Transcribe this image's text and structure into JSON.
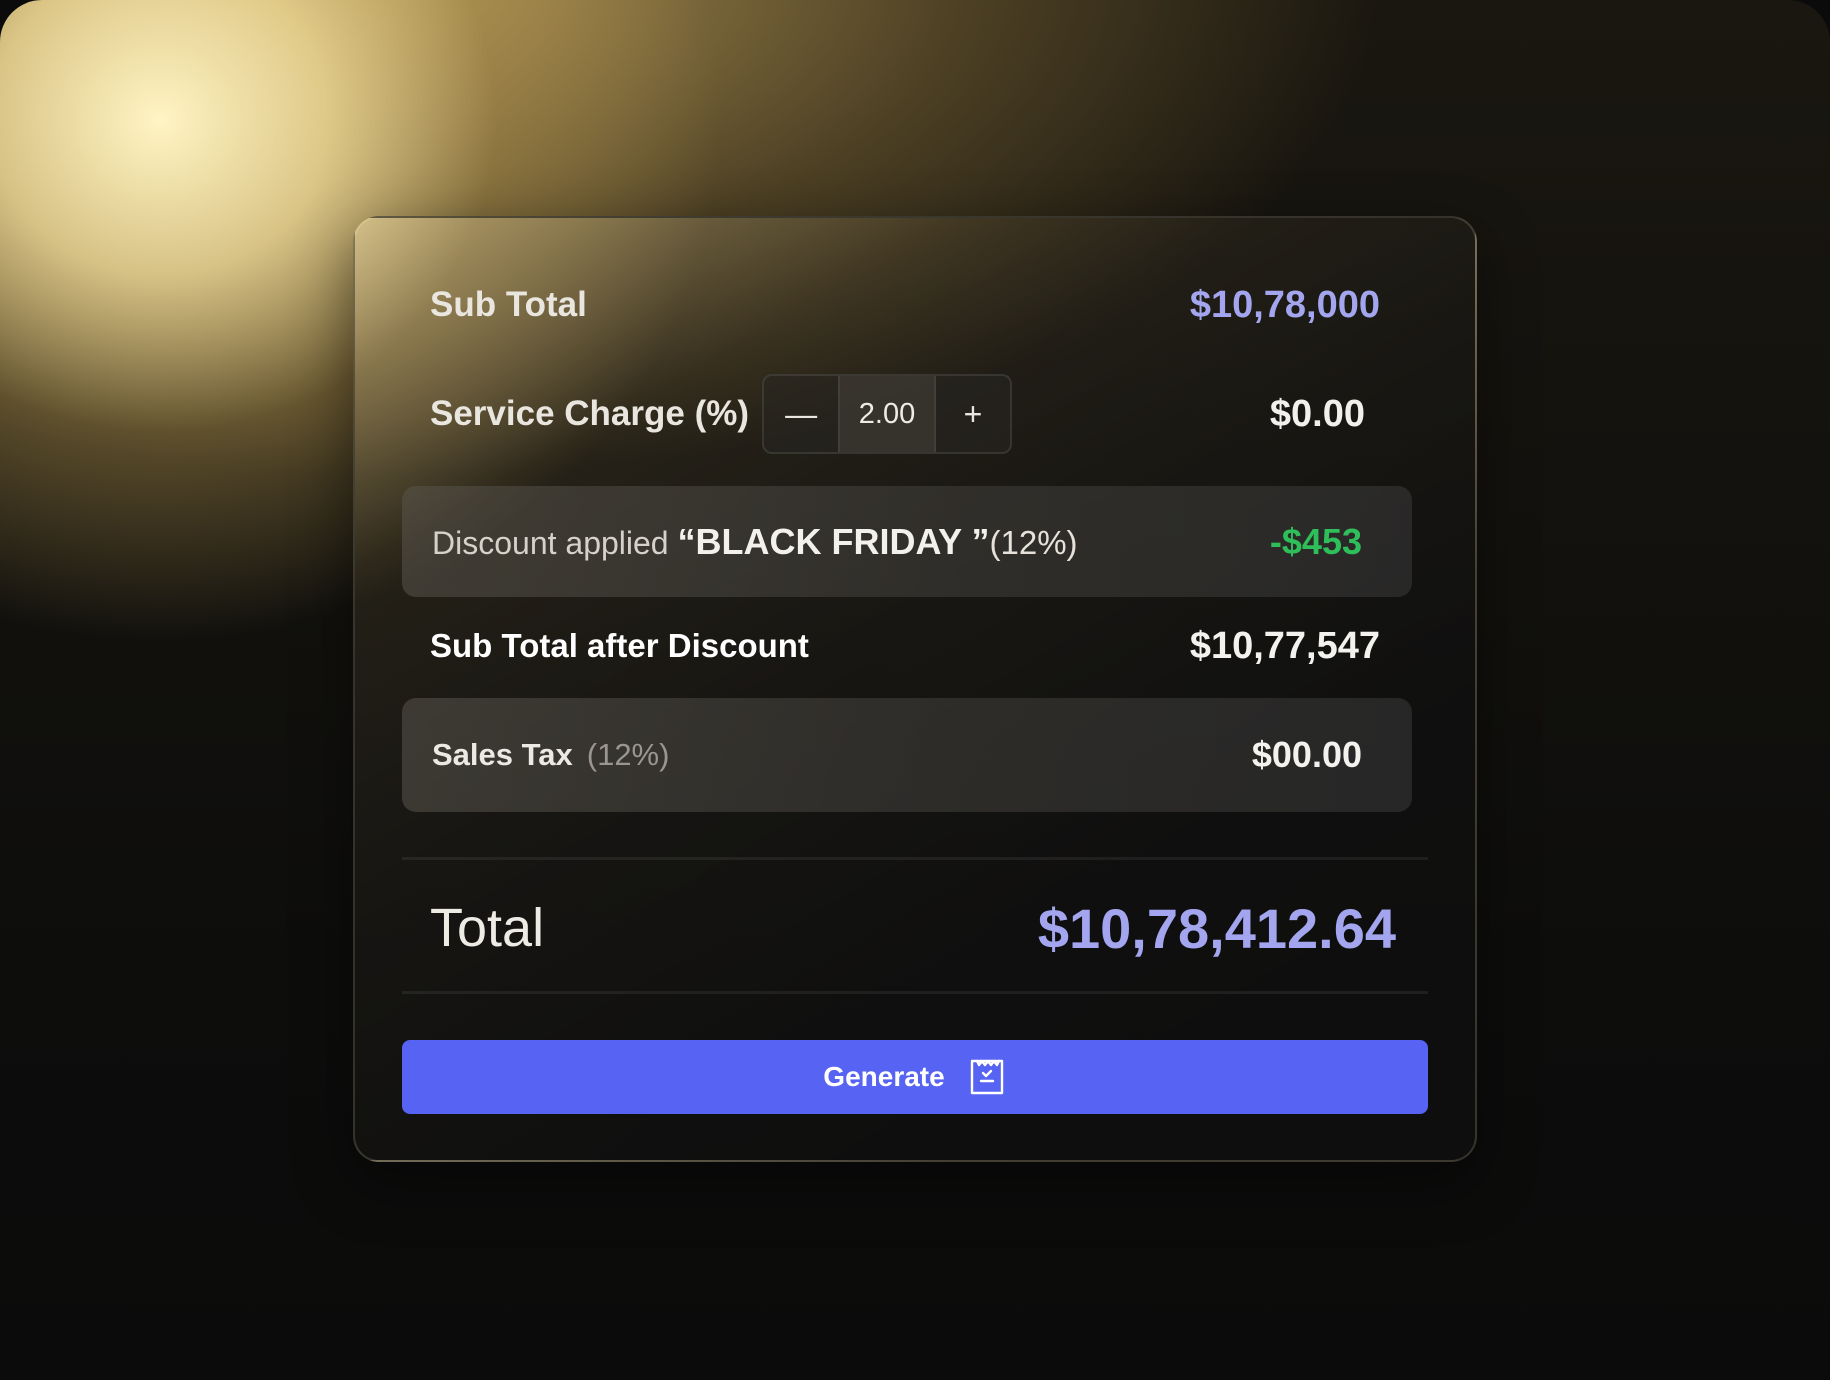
{
  "summary": {
    "sub_total": {
      "label": "Sub Total",
      "value": "$10,78,000"
    },
    "service_charge": {
      "label": "Service Charge (%)",
      "decrement": "—",
      "amount": "2.00",
      "increment": "+",
      "value": "$0.00"
    },
    "discount": {
      "prefix": "Discount applied",
      "code": "“BLACK FRIDAY ”",
      "percent": "(12%)",
      "value": "-$453"
    },
    "sub_total_after_discount": {
      "label": "Sub Total after Discount",
      "value": "$10,77,547"
    },
    "sales_tax": {
      "label": "Sales Tax",
      "percent": "(12%)",
      "value": "$00.00"
    },
    "total": {
      "label": "Total",
      "value": "$10,78,412.64"
    }
  },
  "actions": {
    "generate_label": "Generate",
    "generate_icon": "receipt-icon"
  },
  "colors": {
    "accent": "#5763f2",
    "highlight_value": "#a3a6ee",
    "discount_value": "#2fbf5a"
  }
}
